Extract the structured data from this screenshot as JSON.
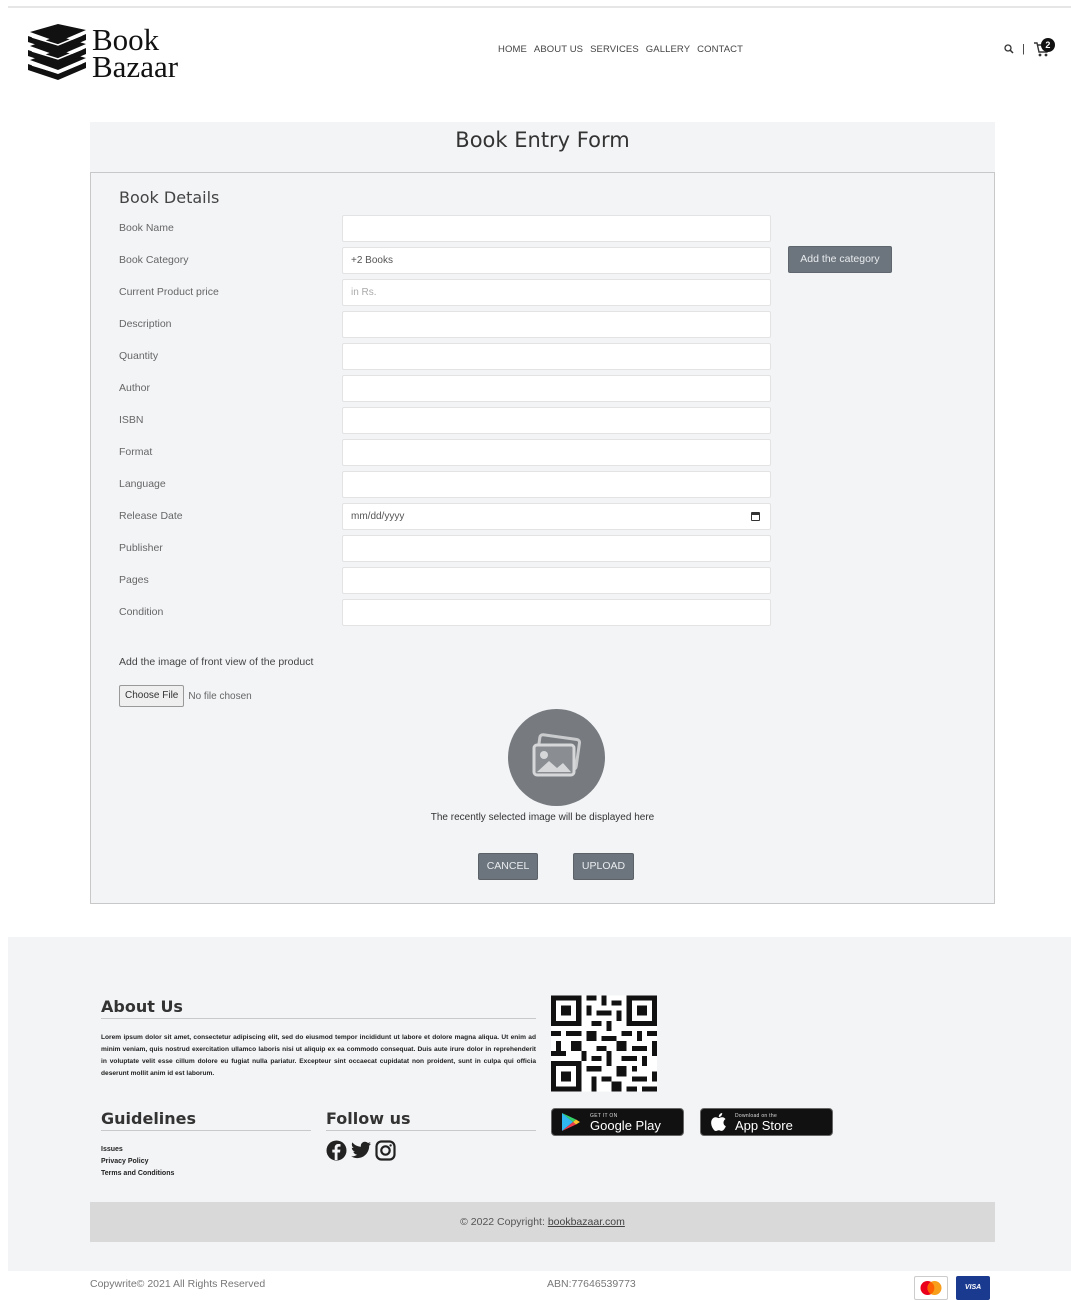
{
  "header": {
    "logo_line1": "Book",
    "logo_line2": "Bazaar",
    "nav": [
      "HOME",
      "ABOUT US",
      "SERVICES",
      "GALLERY",
      "CONTACT"
    ],
    "search_symbol": "⚲",
    "separator": "|",
    "cart_count": "2"
  },
  "form": {
    "title": "Book Entry Form",
    "section_title": "Book Details",
    "fields": [
      {
        "label": "Book Name",
        "value": "",
        "placeholder": ""
      },
      {
        "label": "Book Category",
        "value": "+2 Books",
        "placeholder": ""
      },
      {
        "label": "Current Product price",
        "value": "",
        "placeholder": "in Rs."
      },
      {
        "label": "Description",
        "value": "",
        "placeholder": ""
      },
      {
        "label": "Quantity",
        "value": "",
        "placeholder": ""
      },
      {
        "label": "Author",
        "value": "",
        "placeholder": ""
      },
      {
        "label": "ISBN",
        "value": "",
        "placeholder": ""
      },
      {
        "label": "Format",
        "value": "",
        "placeholder": ""
      },
      {
        "label": "Language",
        "value": "",
        "placeholder": ""
      },
      {
        "label": "Release Date",
        "value": "",
        "placeholder": "mm/dd/yyyy"
      },
      {
        "label": "Publisher",
        "value": "",
        "placeholder": ""
      },
      {
        "label": "Pages",
        "value": "",
        "placeholder": ""
      },
      {
        "label": "Condition",
        "value": "",
        "placeholder": ""
      }
    ],
    "add_category_label": "Add the category",
    "image_label": "Add the image of front view of the product",
    "choose_file_label": "Choose File",
    "file_status": "No file chosen",
    "image_caption": "The recently selected image will be displayed here",
    "cancel_label": "CANCEL",
    "upload_label": "UPLOAD"
  },
  "footer": {
    "about_title": "About Us",
    "about_text": "Lorem ipsum dolor sit amet, consectetur adipiscing elit, sed do eiusmod tempor incididunt ut labore et dolore magna aliqua. Ut enim ad minim veniam, quis nostrud exercitation ullamco laboris nisi ut aliquip ex ea commodo consequat. Duis aute irure dolor in reprehenderit in voluptate velit esse cillum dolore eu fugiat nulla pariatur. Excepteur sint occaecat cupidatat non proident, sunt in culpa qui officia deserunt mollit anim id est laborum.",
    "guidelines_title": "Guidelines",
    "guidelines": [
      "Issues",
      "Privacy Policy",
      "Terms and Conditions"
    ],
    "follow_title": "Follow us",
    "google_small": "GET IT ON",
    "google_big": "Google Play",
    "apple_small": "Download on the",
    "apple_big": "App Store",
    "copyright_prefix": "© 2022 Copyright:",
    "copyright_link": "bookbazaar.com",
    "bottom_left": "Copywrite© 2021 All Rights Reserved",
    "abn": "ABN:77646539773",
    "visa_label": "VISA"
  }
}
